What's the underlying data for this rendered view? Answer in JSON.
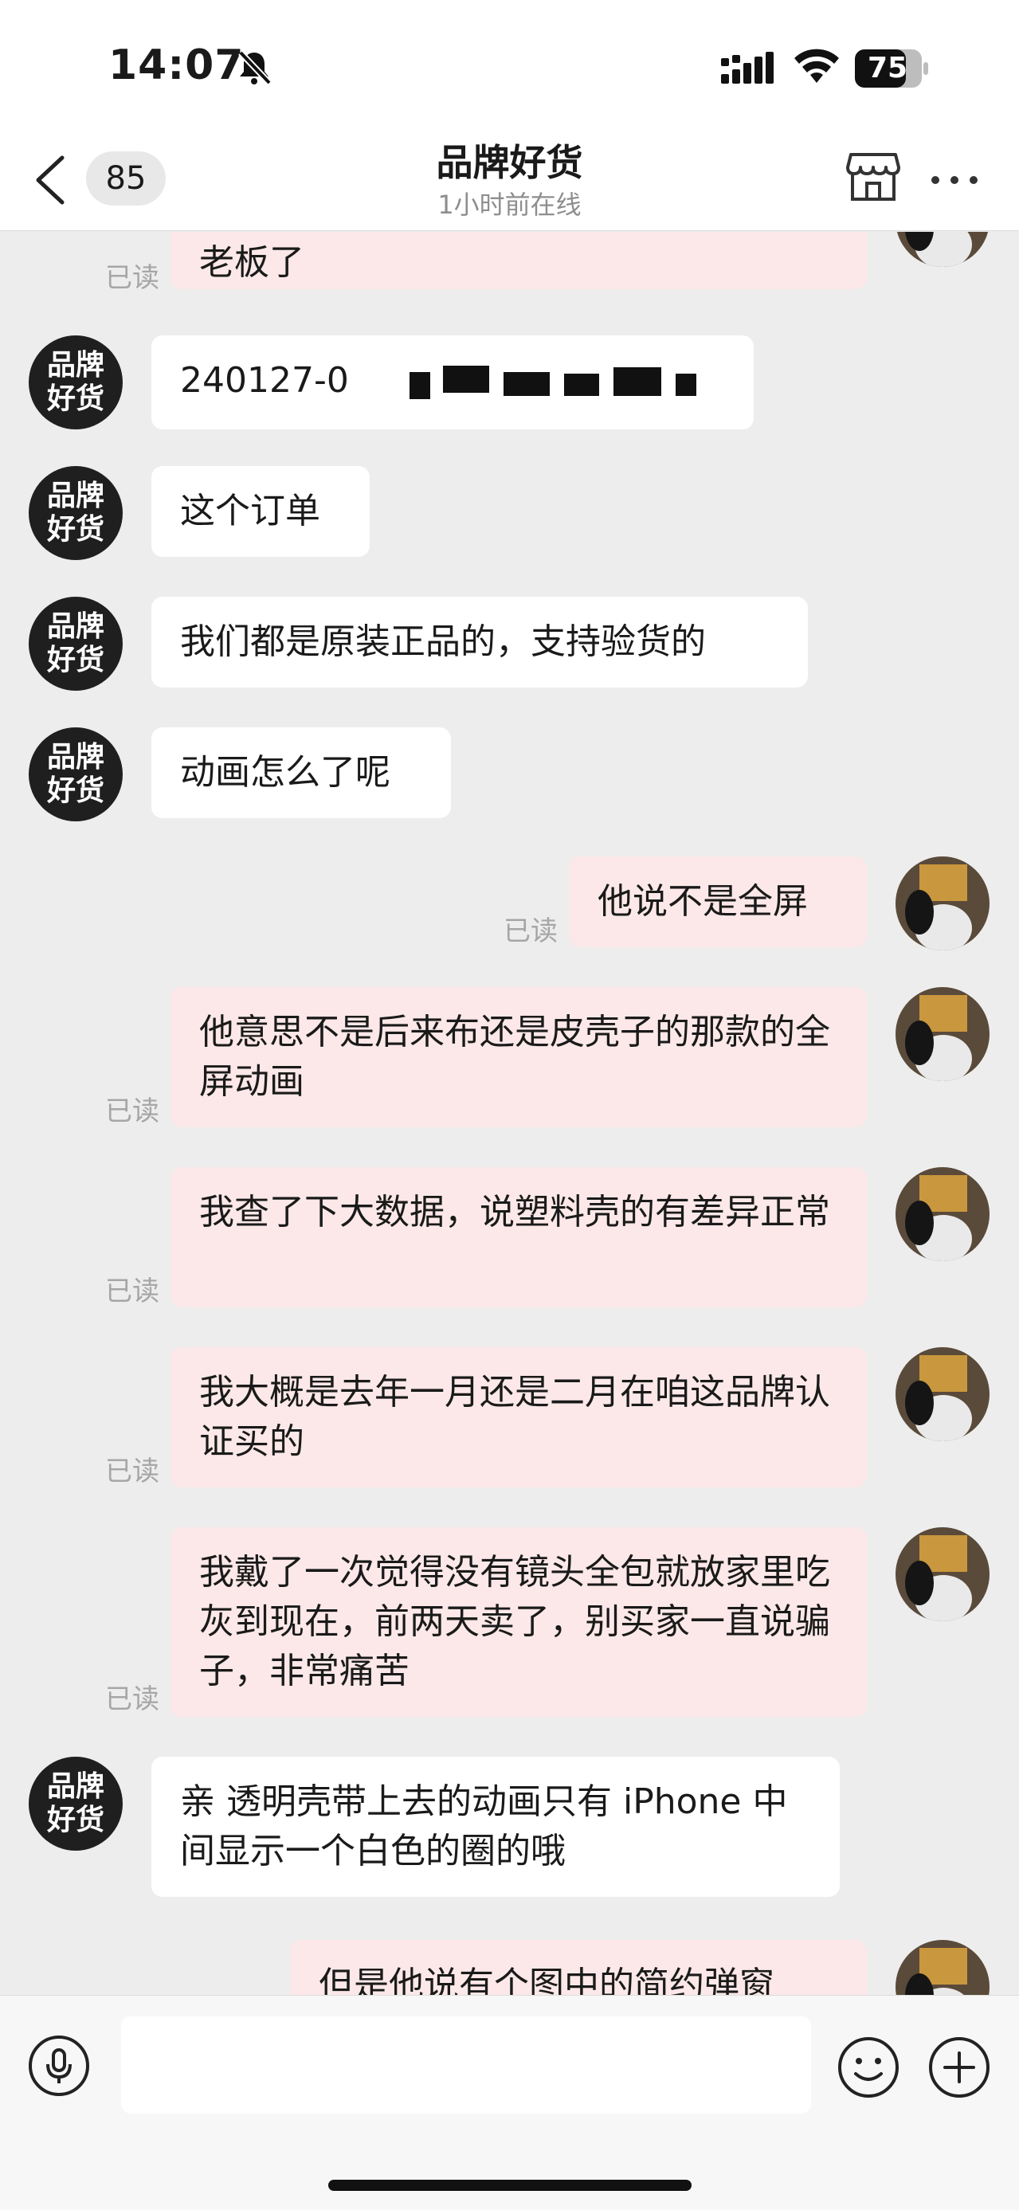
{
  "status_bar": {
    "time": "14:07",
    "battery": "75",
    "icons": [
      "bell-slash-icon",
      "cellular-signal-icon",
      "wifi-icon",
      "battery-icon"
    ]
  },
  "nav": {
    "unread_count": "85",
    "title": "品牌好货",
    "subtitle": "1小时前在线",
    "icons": [
      "back-chevron-icon",
      "store-icon",
      "more-icon"
    ]
  },
  "shop_avatar_text": "品牌好货",
  "read_label": "已读",
  "messages": [
    {
      "side": "out",
      "text": "老板了",
      "read": true
    },
    {
      "side": "in",
      "text": "240127-0"
    },
    {
      "side": "in",
      "text": "这个订单"
    },
    {
      "side": "in",
      "text": "我们都是原装正品的，支持验货的"
    },
    {
      "side": "in",
      "text": "动画怎么了呢"
    },
    {
      "side": "out",
      "text": "他说不是全屏",
      "read": true
    },
    {
      "side": "out",
      "text": "他意思不是后来布还是皮壳子的那款的全屏动画",
      "read": true
    },
    {
      "side": "out",
      "text": "我查了下大数据，说塑料壳的有差异正常",
      "read": true
    },
    {
      "side": "out",
      "text": "我大概是去年一月还是二月在咱这品牌认证买的",
      "read": true
    },
    {
      "side": "out",
      "text": "我戴了一次觉得没有镜头全包就放家里吃灰到现在，前两天卖了，别买家一直说骗子，非常痛苦",
      "read": true
    },
    {
      "side": "in",
      "text": "亲 透明壳带上去的动画只有 iPhone 中间显示一个白色的圈的哦"
    },
    {
      "side": "out",
      "text": "但是他说有个图中的简约弹窗",
      "read": true
    }
  ],
  "input_bar": {
    "icons": [
      "microphone-icon",
      "emoji-icon",
      "plus-icon"
    ]
  },
  "colors": {
    "chat_background": "#ededed",
    "incoming_bubble": "#ffffff",
    "outgoing_bubble": "#fce8e8",
    "read_text": "#a6a6a6"
  }
}
